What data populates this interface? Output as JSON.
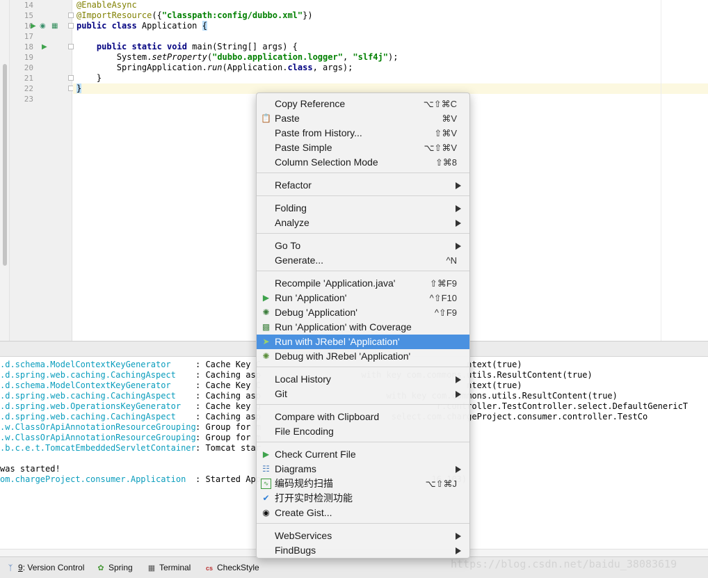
{
  "editor": {
    "line_numbers": [
      "14",
      "15",
      "16",
      "17",
      "18",
      "19",
      "20",
      "21",
      "22",
      "23"
    ],
    "code": {
      "l14_annotation": "@EnableAsync",
      "l15_annotation": "@ImportResource",
      "l15_open": "({",
      "l15_string": "\"classpath:config/dubbo.xml\"",
      "l15_close": "})",
      "l16_kw": "public class",
      "l16_name": " Application ",
      "l16_brace": "{",
      "l18_kw": "public static void",
      "l18_rest": " main(String[] args) {",
      "l19_a": "System.",
      "l19_method": "setProperty",
      "l19_b": "(",
      "l19_s1": "\"dubbo.application.logger\"",
      "l19_c": ", ",
      "l19_s2": "\"slf4j\"",
      "l19_d": ");",
      "l20_a": "SpringApplication.",
      "l20_method": "run",
      "l20_b": "(Application.",
      "l20_kw": "class",
      "l20_c": ", args);",
      "l21": "}",
      "l22": "}"
    }
  },
  "console": {
    "lines": [
      {
        "cls": ".d.schema.ModelContextKeyGenerator",
        "msg": ": Cache Key C                                         ntext(true)"
      },
      {
        "cls": ".d.spring.web.caching.CachingAspect",
        "msg": ": Caching asp                    with key com.commons.utils.ResultContent(true)"
      },
      {
        "cls": ".d.schema.ModelContextKeyGenerator",
        "msg": ": Cache Key C                                         ntext(true)"
      },
      {
        "cls": ".d.spring.web.caching.CachingAspect",
        "msg": ": Caching asp                         with key com.commons.utils.ResultContent(true)"
      },
      {
        "cls": ".d.spring.web.OperationsKeyGenerator",
        "msg": ": Cache key g                                   r.controller.TestController.select.DefaultGenericT"
      },
      {
        "cls": ".d.spring.web.caching.CachingAspect",
        "msg": ": Caching asp                          select.com.chargeProject.consumer.controller.TestCo"
      },
      {
        "cls": ".w.ClassOrApiAnnotationResourceGrouping",
        "msg": ": Group for m"
      },
      {
        "cls": ".w.ClassOrApiAnnotationResourceGrouping",
        "msg": ": Group for m"
      },
      {
        "cls": ".b.c.e.t.TomcatEmbeddedServletContainer",
        "msg": ": Tomcat star"
      },
      {
        "plain": "was started!"
      },
      {
        "cls": "om.chargeProject.consumer.Application",
        "msg": ": Started App                                  16.103)"
      }
    ]
  },
  "toolbar": {
    "version_control": {
      "num": "9",
      "label": ": Version Control"
    },
    "spring": "Spring",
    "terminal": "Terminal",
    "checkstyle": "CheckStyle",
    "checkstyle_icon": "cs"
  },
  "watermark": "https://blog.csdn.net/baidu_38083619",
  "context_menu": {
    "items": [
      {
        "label": "Copy Reference",
        "shortcut": "⌥⇧⌘C"
      },
      {
        "label": "Paste",
        "shortcut": "⌘V",
        "icon": "paste-icon"
      },
      {
        "label": "Paste from History...",
        "shortcut": "⇧⌘V"
      },
      {
        "label": "Paste Simple",
        "shortcut": "⌥⇧⌘V"
      },
      {
        "label": "Column Selection Mode",
        "shortcut": "⇧⌘8"
      },
      {
        "label": "Refactor",
        "submenu": true
      },
      {
        "label": "Folding",
        "submenu": true
      },
      {
        "label": "Analyze",
        "submenu": true
      },
      {
        "label": "Go To",
        "submenu": true
      },
      {
        "label": "Generate...",
        "shortcut": "^N"
      },
      {
        "label": "Recompile 'Application.java'",
        "shortcut": "⇧⌘F9"
      },
      {
        "label": "Run 'Application'",
        "shortcut": "^⇧F10",
        "icon": "run-icon"
      },
      {
        "label": "Debug 'Application'",
        "shortcut": "^⇧F9",
        "icon": "debug-icon"
      },
      {
        "label": "Run 'Application' with Coverage",
        "icon": "coverage-icon"
      },
      {
        "label": "Run with JRebel 'Application'",
        "icon": "jrebel-run-icon",
        "selected": true
      },
      {
        "label": "Debug with JRebel 'Application'",
        "icon": "jrebel-debug-icon"
      },
      {
        "label": "Local History",
        "submenu": true
      },
      {
        "label": "Git",
        "submenu": true
      },
      {
        "label": "Compare with Clipboard"
      },
      {
        "label": "File Encoding"
      },
      {
        "label": "Check Current File",
        "icon": "checkstyle-run-icon"
      },
      {
        "label": "Diagrams",
        "submenu": true,
        "icon": "diagram-icon"
      },
      {
        "label": "编码规约扫描",
        "shortcut": "⌥⇧⌘J",
        "icon": "p3c-scan-icon"
      },
      {
        "label": "打开实时检测功能",
        "icon": "realtime-check-icon"
      },
      {
        "label": "Create Gist...",
        "icon": "github-icon"
      },
      {
        "label": "WebServices",
        "submenu": true
      },
      {
        "label": "FindBugs",
        "submenu": true
      }
    ]
  },
  "colors": {
    "menu_selection": "#4a91e0",
    "console_class": "#0a9dbd",
    "keyword": "#000080",
    "string": "#008000",
    "annotation": "#808000",
    "current_line": "#fcf8e0"
  }
}
